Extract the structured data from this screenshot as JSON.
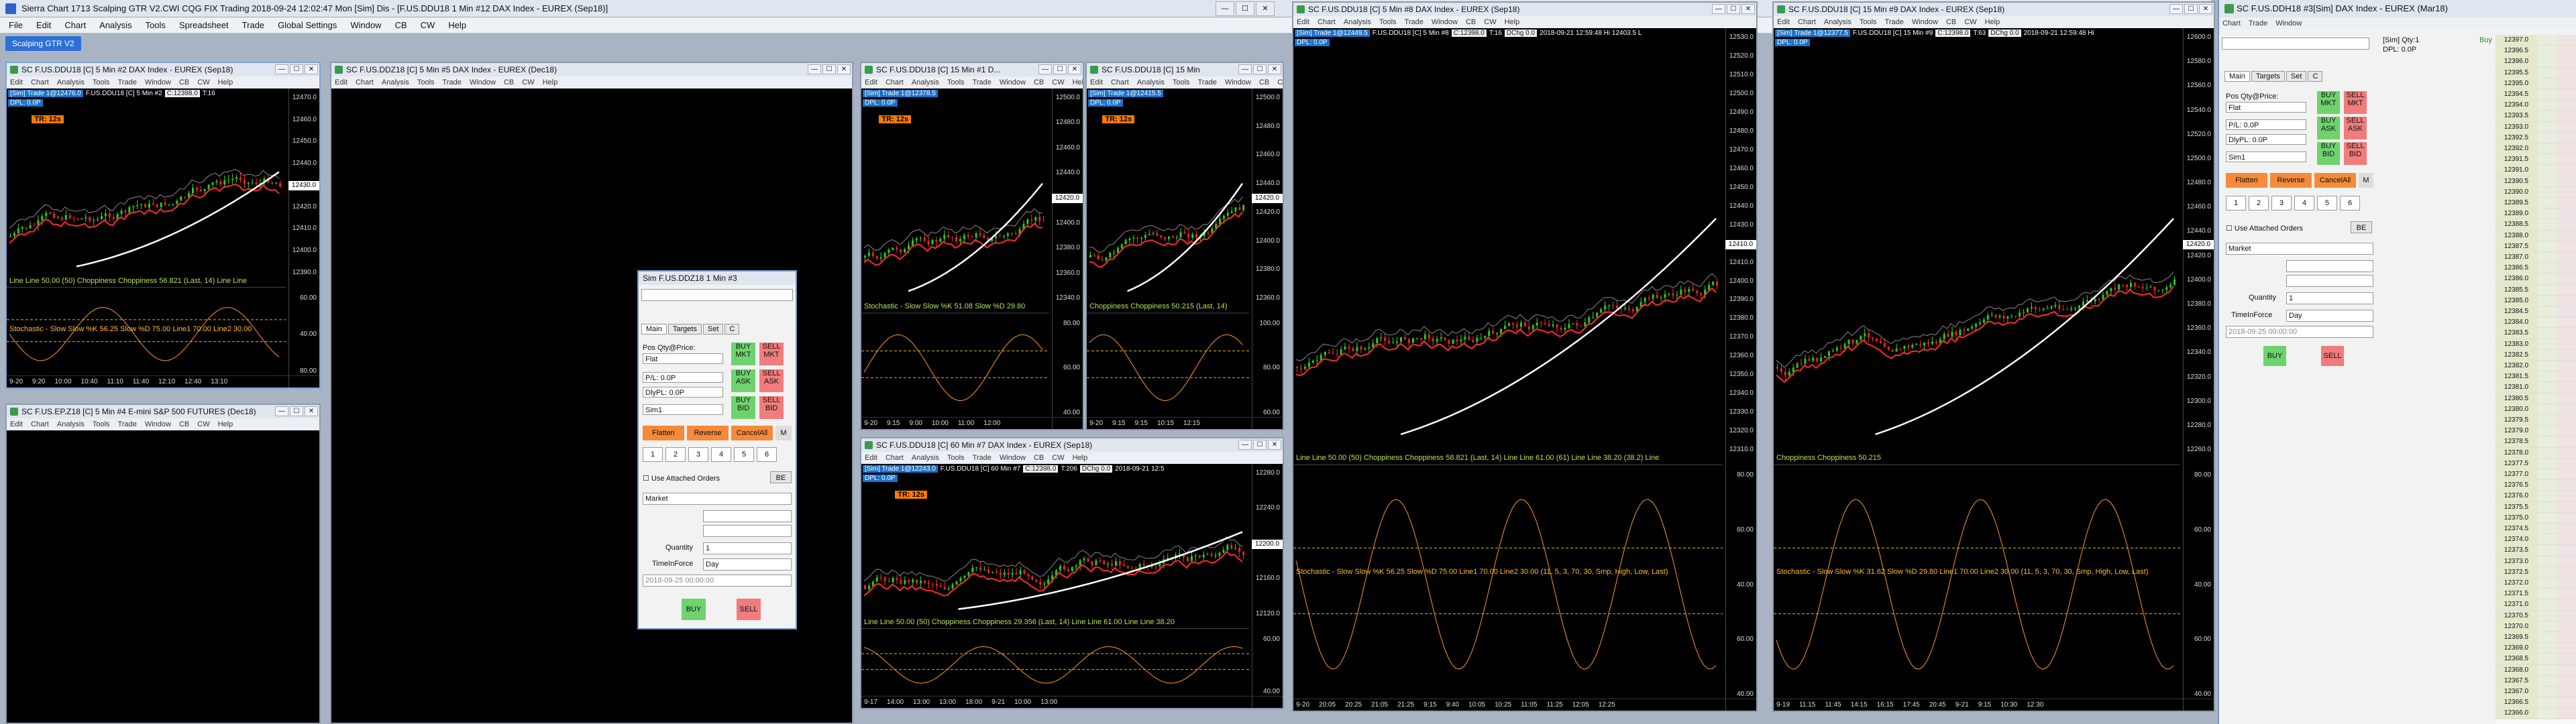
{
  "app": {
    "title": "Sierra Chart 1713 Scalping GTR V2.CWI  CQG FIX Trading 2018-09-24  12:02:47 Mon [Sim] Dis - [F.US.DDU18  1 Min  #12  DAX Index - EUREX (Sep18)]",
    "menu": [
      "File",
      "Edit",
      "Chart",
      "Analysis",
      "Tools",
      "Spreadsheet",
      "Trade",
      "Global Settings",
      "Window",
      "CB",
      "CW",
      "Help"
    ],
    "toolbar_button": "Scalping GTR V2"
  },
  "subwin_menu": [
    "Edit",
    "Chart",
    "Analysis",
    "Tools",
    "Trade",
    "Window",
    "CB",
    "CW",
    "Help"
  ],
  "windows": [
    {
      "title": "SC F.US.DDU18 [C]  5 Min  #2  DAX Index - EUREX (Sep18)",
      "tag": "[Sim]  Trade 1@12476.0",
      "tag2": "F.US.DDU18 [C]  5 Min  #2",
      "tag3": "C:12398.0",
      "tag4": "T:16",
      "dpl": "DPL: 0.0P",
      "tr": "TR: 12s",
      "scale": [
        "12470.0",
        "12460.0",
        "12450.0",
        "12440.0",
        "12430.0",
        "12420.0",
        "12410.0",
        "12400.0",
        "12390.0"
      ],
      "ind": "Line  Line 50.00   (50)  Choppiness  Choppiness 56.821   (Last, 14)  Line  Line",
      "ind2": "Stochastic - Slow  Slow %K 56.25   Slow %D 75.00   Line1 70.00   Line2 30.00",
      "ind_scale": [
        "60.00",
        "40.00",
        "80.00"
      ],
      "dates": [
        "9-20",
        "9:20",
        "10:00",
        "10:40",
        "11:10",
        "11:40",
        "12:10",
        "12:40",
        "13:10"
      ]
    },
    {
      "title": "SC F.US.DDZ18 [C]  5 Min  #5  DAX Index - EUREX (Dec18)"
    },
    {
      "title": "SC F.US.EP.Z18 [C]  5 Min  #4  E-mini S&P 500 FUTURES (Dec18)"
    },
    {
      "title": "SC F.US.DDU18 [C]  15 Min  #1  D...",
      "tag": "[Sim]  Trade 1@12378.5",
      "dpl": "DPL: 0.0P",
      "tr": "TR: 12s",
      "scale": [
        "12500.0",
        "12480.0",
        "12460.0",
        "12440.0",
        "12420.0",
        "12400.0",
        "12380.0",
        "12360.0",
        "12340.0"
      ],
      "ind": "Stochastic - Slow  Slow %K 51.08  Slow %D 29.80",
      "ind_scale": [
        "80.00",
        "60.00",
        "40.00"
      ],
      "dates": [
        "9-20",
        "9:15",
        "9:00",
        "10:00",
        "11:00",
        "12:00"
      ]
    },
    {
      "title": "SC F.US.DDU18 [C]  15 Min",
      "tag": "[Sim]  Trade 1@12415.5",
      "dpl": "DPL: 0.0P",
      "tr": "TR: 12s",
      "scale": [
        "12500.0",
        "12480.0",
        "12460.0",
        "12440.0",
        "12420.0",
        "12400.0",
        "12380.0",
        "12360.0"
      ],
      "ind": "Choppiness  Choppiness 50.215   (Last, 14)",
      "ind_scale": [
        "100.00",
        "80.00",
        "60.00"
      ],
      "dates": [
        "9-20",
        "9:15",
        "9:15",
        "10:15",
        "12:15"
      ]
    },
    {
      "title": "SC F.US.DDU18 [C]  60 Min  #7  DAX Index - EUREX (Sep18)",
      "tag": "[Sim]  Trade 1@12243.0",
      "tag2": "F.US.DDU18 [C]  60 Min  #7",
      "tag3": "C:12398.0",
      "tag4": "T:206",
      "tag5": "DChg 0.0",
      "tag6": "2018-09-21  12:5",
      "dpl": "DPL: 0.0P",
      "tr": "TR: 12s",
      "scale": [
        "12280.0",
        "12240.0",
        "12200.0",
        "12160.0",
        "12120.0"
      ],
      "ind": "Line  Line 50.00   (50)  Choppiness  Choppiness 29.356   (Last, 14)  Line  Line 61.00   Line  Line 38.20",
      "ind_scale": [
        "60.00",
        "40.00"
      ],
      "dates": [
        "9-17",
        "14:00",
        "13:00",
        "13:00",
        "18:00",
        "9-21",
        "10:00",
        "13:00"
      ]
    },
    {
      "title": "SC F.US.DDU18 [C]  5 Min  #8  DAX Index - EUREX (Sep18)",
      "tag": "[Sim]  Trade 1@12449.5",
      "tag2": "F.US.DDU18 [C]  5 Min  #8",
      "tag3": "C:12398.0",
      "tag4": "T:16",
      "tag5": "DChg 0.0",
      "tag6": "2018-09-21  12:59:48 Hi 12403.5 L",
      "dpl": "DPL: 0.0P",
      "scale": [
        "12530.0",
        "12520.0",
        "12510.0",
        "12500.0",
        "12490.0",
        "12480.0",
        "12470.0",
        "12460.0",
        "12450.0",
        "12440.0",
        "12430.0",
        "12420.0",
        "12410.0",
        "12400.0",
        "12390.0",
        "12380.0",
        "12370.0",
        "12360.0",
        "12350.0",
        "12340.0",
        "12330.0",
        "12320.0",
        "12310.0"
      ],
      "ind": "Line  Line 50.00   (50)  Choppiness  Choppiness 58.821   (Last, 14)  Line  Line 61.00   (61)  Line  Line 38.20   (38.2)  Line",
      "ind2": "Stochastic - Slow  Slow %K 56.25   Slow %D 75.00   Line1 70.00   Line2 30.00   (11, 5, 3, 70, 30, Smp, High, Low, Last)",
      "ind_scale": [
        "80.00",
        "60.00",
        "40.00",
        "60.00",
        "40.00"
      ],
      "dates": [
        "9-20",
        "20:05",
        "20:25",
        "21:05",
        "21:25",
        "9:15",
        "9:40",
        "10:05",
        "10:25",
        "11:05",
        "11:25",
        "12:05",
        "12:25"
      ]
    },
    {
      "title": "SC F.US.DDU18 [C]  15 Min  #9  DAX Index - EUREX (Sep18)",
      "tag": "[Sim]  Trade 1@12377.5",
      "tag2": "F.US.DDU18 [C]  15 Min  #9",
      "tag3": "C:12398.0",
      "tag4": "T:63",
      "tag5": "DChg 0.0",
      "tag6": "2018-09-21  12:59:48 Hi",
      "dpl": "DPL: 0.0P",
      "scale": [
        "12600.0",
        "12580.0",
        "12560.0",
        "12540.0",
        "12520.0",
        "12500.0",
        "12480.0",
        "12460.0",
        "12440.0",
        "12420.0",
        "12400.0",
        "12380.0",
        "12360.0",
        "12340.0",
        "12320.0",
        "12300.0",
        "12280.0",
        "12260.0"
      ],
      "ind": "Choppiness  Choppiness 50.215",
      "ind2": "Stochastic - Slow  Slow %K 31.62   Slow %D 29.80   Line1 70.00   Line2 30.00   (11, 5, 3, 70, 30, Smp, High, Low, Last)",
      "ind_scale": [
        "80.00",
        "60.00",
        "40.00",
        "60.00",
        "40.00"
      ],
      "dates": [
        "9-19",
        "11:15",
        "11:45",
        "14:15",
        "16:15",
        "17:45",
        "20:45",
        "9-21",
        "9:15",
        "10:30",
        "12:30"
      ]
    }
  ],
  "trade_panel": {
    "title": "Sim F.US.DDZ18  1 Min  #3",
    "tabs": [
      "Main",
      "Targets",
      "Set",
      "C"
    ],
    "pos_label": "Pos Qty@Price:",
    "pos_value": "Flat",
    "pl_label": "P/L: 0.0P",
    "dpl_label": "DlyPL: 0.0P",
    "account": "Sim1",
    "btn_buy_mkt": "BUY MKT",
    "btn_sell_mkt": "SELL MKT",
    "btn_buy_ask": "BUY ASK",
    "btn_sell_ask": "SELL ASK",
    "btn_buy_bid": "BUY BID",
    "btn_sell_bid": "SELL BID",
    "btn_flatten": "Flatten",
    "btn_reverse": "Reverse",
    "btn_cancel": "CancelAll",
    "btn_m": "M",
    "qty_nums": [
      "1",
      "2",
      "3",
      "4",
      "5",
      "6"
    ],
    "attached_label": "Use Attached Orders",
    "be": "BE",
    "order_type": "Market",
    "quantity_label": "Quantity",
    "quantity": "1",
    "tif_label": "TimeInForce",
    "tif": "Day",
    "date_field": "2018-09-25  00:00:00",
    "buy": "BUY",
    "sell": "SELL"
  },
  "dom": {
    "title": "SC F.US.DDH18 #3[Sim]  DAX Index - EUREX (Mar18)",
    "menu": [
      "Chart",
      "Trade",
      "Window"
    ],
    "sim_qty": "[Sim]  Qty:1",
    "dpl": "DPL: 0.0P",
    "buy_hdr": "Buy",
    "prices": [
      "12397.0",
      "12396.5",
      "12396.0",
      "12395.5",
      "12395.0",
      "12394.5",
      "12394.0",
      "12393.5",
      "12393.0",
      "12392.5",
      "12392.0",
      "12391.5",
      "12391.0",
      "12390.5",
      "12390.0",
      "12389.5",
      "12389.0",
      "12388.5",
      "12388.0",
      "12387.5",
      "12387.0",
      "12386.5",
      "12386.0",
      "12385.5",
      "12385.0",
      "12384.5",
      "12384.0",
      "12383.5",
      "12383.0",
      "12382.5",
      "12382.0",
      "12381.5",
      "12381.0",
      "12380.5",
      "12380.0",
      "12379.5",
      "12379.0",
      "12378.5",
      "12378.0",
      "12377.5",
      "12377.0",
      "12376.5",
      "12376.0",
      "12375.5",
      "12375.0",
      "12374.5",
      "12374.0",
      "12373.5",
      "12373.0",
      "12372.5",
      "12372.0",
      "12371.5",
      "12371.0",
      "12370.5",
      "12370.0",
      "12369.5",
      "12369.0",
      "12368.5",
      "12368.0",
      "12367.5",
      "12367.0",
      "12366.5",
      "12366.0"
    ]
  }
}
